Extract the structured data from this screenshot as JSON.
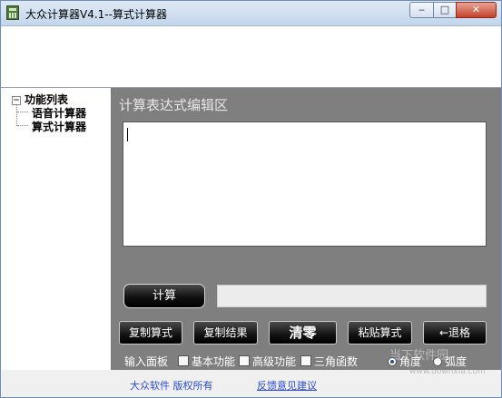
{
  "window": {
    "title": "大众计算器V4.1--算式计算器",
    "controls": {
      "minimize": "‒",
      "maximize": "□",
      "close": "✕"
    }
  },
  "sidebar": {
    "root": {
      "expander": "−",
      "label": "功能列表"
    },
    "items": [
      {
        "label": "语音计算器"
      },
      {
        "label": "算式计算器"
      }
    ]
  },
  "main": {
    "editor_title": "计算表达式编辑区",
    "editor_value": "",
    "calc_button": "计算",
    "result_value": "",
    "buttons": {
      "copy_expr": "复制算式",
      "copy_result": "复制结果",
      "clear": "清零",
      "paste_expr": "粘贴算式",
      "backspace": "←退格"
    },
    "options": {
      "input_panel_label": "输入面板",
      "basic": "基本功能",
      "advanced": "高级功能",
      "trig": "三角函数",
      "degree": "角度",
      "radian": "弧度"
    }
  },
  "footer": {
    "copyright": "大众软件 版权所有",
    "feedback": "反馈意见建议"
  },
  "watermark": {
    "text": "当下软件园",
    "url": "www.downxia.com"
  }
}
